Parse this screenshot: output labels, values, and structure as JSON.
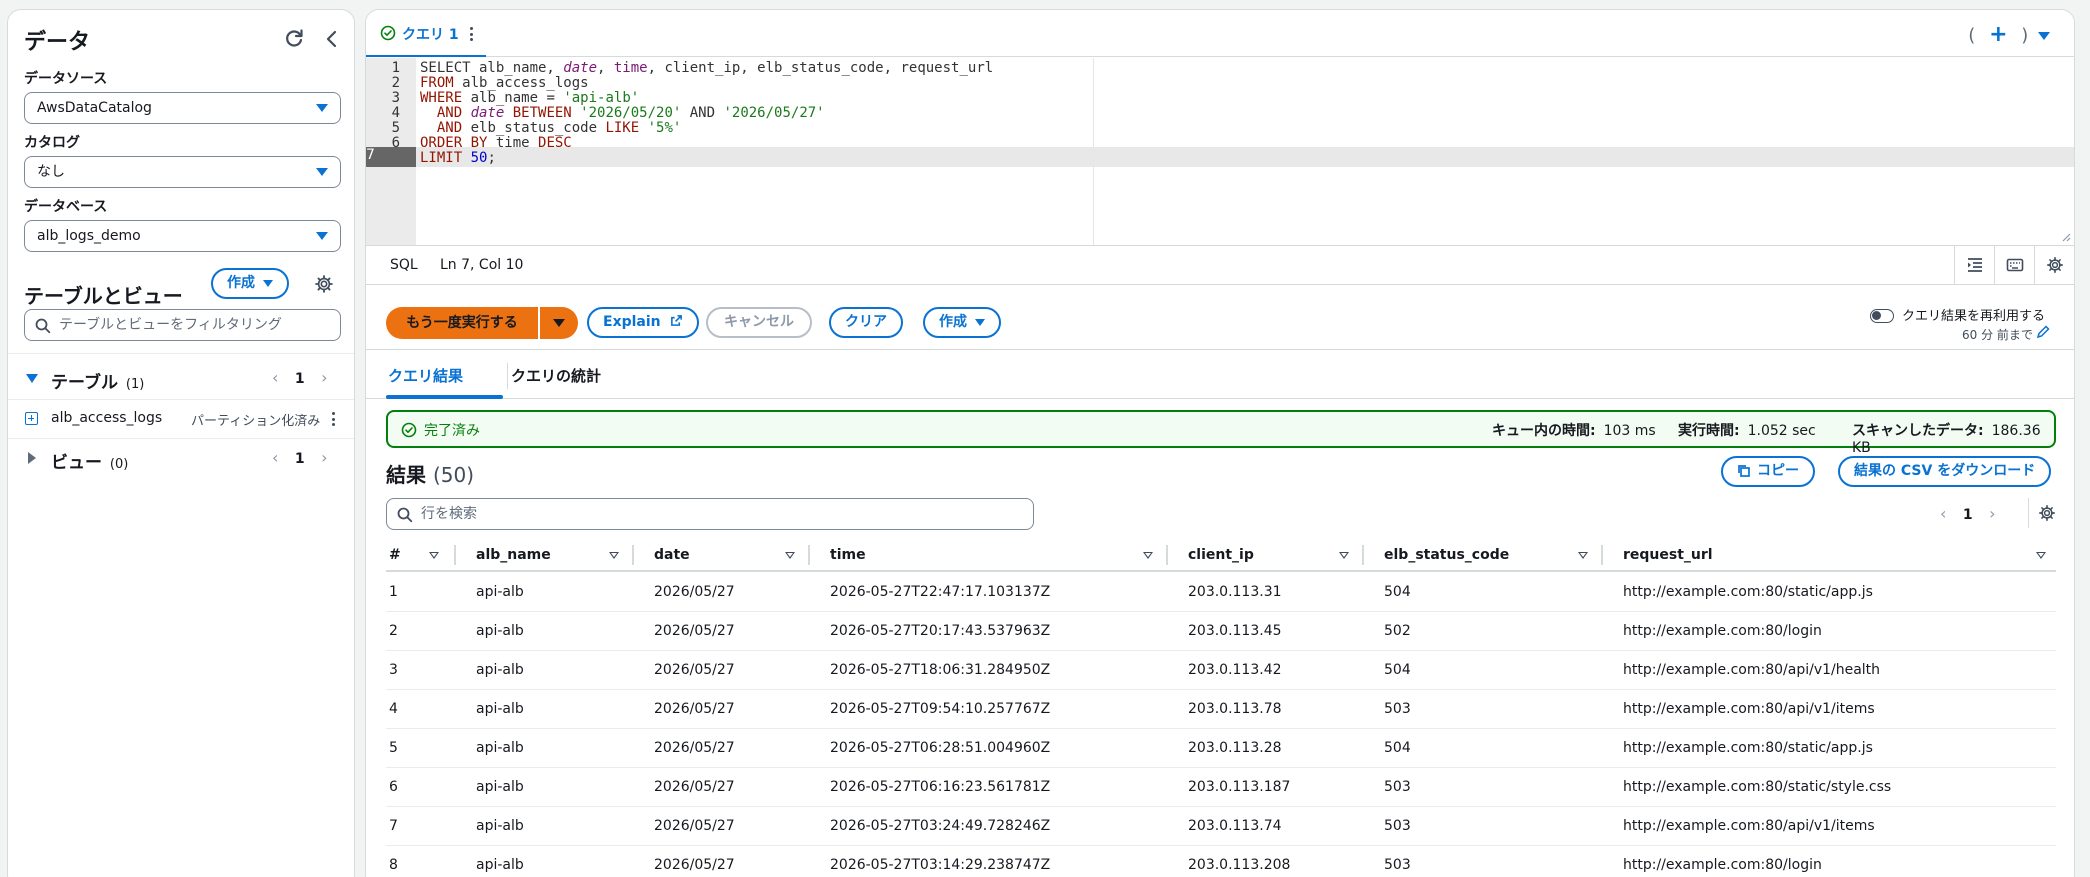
{
  "left": {
    "title": "データ",
    "datasource_label": "データソース",
    "datasource_value": "AwsDataCatalog",
    "catalog_label": "カタログ",
    "catalog_value": "なし",
    "database_label": "データベース",
    "database_value": "alb_logs_demo",
    "tables_views_title": "テーブルとビュー",
    "create_label": "作成",
    "filter_placeholder": "テーブルとビューをフィルタリング",
    "tables_label": "テーブル",
    "tables_count": "(1)",
    "tables_page": "1",
    "table_item_name": "alb_access_logs",
    "table_item_badge": "パーティション化済み",
    "views_label": "ビュー",
    "views_count": "(0)",
    "views_page": "1"
  },
  "tab": {
    "label": "クエリ 1",
    "right_open": "(",
    "right_plus": "+",
    "right_close": ")"
  },
  "editor": {
    "lines": [
      {
        "num": "1"
      },
      {
        "num": "2"
      },
      {
        "num": "3"
      },
      {
        "num": "4"
      },
      {
        "num": "5"
      },
      {
        "num": "6"
      },
      {
        "num": "7"
      }
    ],
    "tokens": {
      "l1_select": "SELECT",
      "l1_a": " alb_name, ",
      "l1_date": "date",
      "l1_b": ", ",
      "l1_time": "time",
      "l1_c": ", client_ip, elb_status_code, request_url",
      "l2_from": "FROM",
      "l2_a": " alb_access_logs",
      "l3_where": "WHERE",
      "l3_a": " alb_name = ",
      "l3_str": "'api-alb'",
      "l4_and": "  AND ",
      "l4_date": "date",
      "l4_between": " BETWEEN ",
      "l4_s1": "'2026/05/20'",
      "l4_and2": " AND ",
      "l4_s2": "'2026/05/27'",
      "l5_and": "  AND",
      "l5_a": " elb_status_code ",
      "l5_like": "LIKE",
      "l5_sp": " ",
      "l5_str": "'5%'",
      "l6_order": "ORDER BY",
      "l6_a": " time ",
      "l6_desc": "DESC",
      "l7_limit": "LIMIT",
      "l7_sp": " ",
      "l7_num": "50",
      "l7_end": ";"
    }
  },
  "status": {
    "lang": "SQL",
    "position": "Ln 7, Col 10"
  },
  "actions": {
    "run_again": "もう一度実行する",
    "explain": "Explain",
    "cancel": "キャンセル",
    "clear": "クリア",
    "create": "作成",
    "reuse_label": "クエリ結果を再利用する",
    "reuse_sub": "60 分 前まで"
  },
  "results_tabs": {
    "results": "クエリ結果",
    "stats": "クエリの統計"
  },
  "query_status": {
    "label": "完了済み",
    "queue_label": "キュー内の時間:",
    "queue_value": "103 ms",
    "exec_label": "実行時間:",
    "exec_value": "1.052 sec",
    "scan_label": "スキャンしたデータ:",
    "scan_value": "186.36 KB"
  },
  "results": {
    "title": "結果",
    "count": "(50)",
    "copy": "コピー",
    "download": "結果の CSV をダウンロード",
    "search_placeholder": "行を検索",
    "page": "1",
    "columns": [
      "#",
      "alb_name",
      "date",
      "time",
      "client_ip",
      "elb_status_code",
      "request_url"
    ],
    "rows": [
      [
        "1",
        "api-alb",
        "2026/05/27",
        "2026-05-27T22:47:17.103137Z",
        "203.0.113.31",
        "504",
        "http://example.com:80/static/app.js"
      ],
      [
        "2",
        "api-alb",
        "2026/05/27",
        "2026-05-27T20:17:43.537963Z",
        "203.0.113.45",
        "502",
        "http://example.com:80/login"
      ],
      [
        "3",
        "api-alb",
        "2026/05/27",
        "2026-05-27T18:06:31.284950Z",
        "203.0.113.42",
        "504",
        "http://example.com:80/api/v1/health"
      ],
      [
        "4",
        "api-alb",
        "2026/05/27",
        "2026-05-27T09:54:10.257767Z",
        "203.0.113.78",
        "503",
        "http://example.com:80/api/v1/items"
      ],
      [
        "5",
        "api-alb",
        "2026/05/27",
        "2026-05-27T06:28:51.004960Z",
        "203.0.113.28",
        "504",
        "http://example.com:80/static/app.js"
      ],
      [
        "6",
        "api-alb",
        "2026/05/27",
        "2026-05-27T06:16:23.561781Z",
        "203.0.113.187",
        "503",
        "http://example.com:80/static/style.css"
      ],
      [
        "7",
        "api-alb",
        "2026/05/27",
        "2026-05-27T03:24:49.728246Z",
        "203.0.113.74",
        "503",
        "http://example.com:80/api/v1/items"
      ],
      [
        "8",
        "api-alb",
        "2026/05/27",
        "2026-05-27T03:14:29.238747Z",
        "203.0.113.208",
        "503",
        "http://example.com:80/login"
      ]
    ]
  },
  "colors": {
    "accent": "#0972d3",
    "run": "#ec7211",
    "success": "#037f0c"
  }
}
